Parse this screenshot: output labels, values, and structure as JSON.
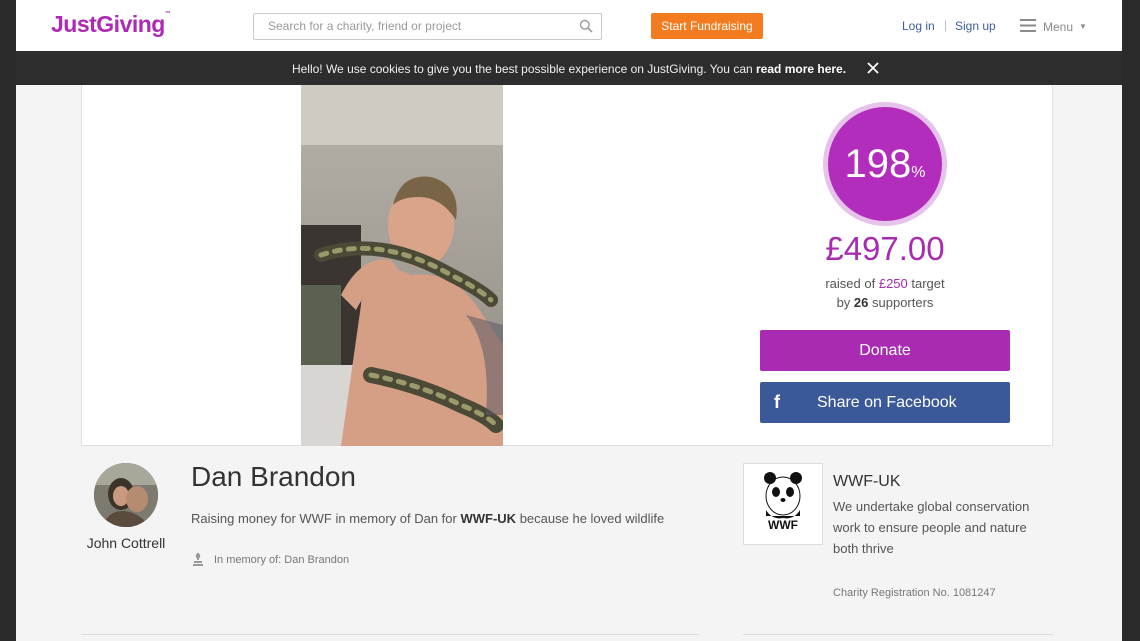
{
  "header": {
    "logo": "JustGiving",
    "logo_tm": "™",
    "search_placeholder": "Search for a charity, friend or project",
    "start_fundraising": "Start Fundraising",
    "login": "Log in",
    "separator": "|",
    "signup": "Sign up",
    "menu": "Menu"
  },
  "cookie_banner": {
    "text": "Hello! We use cookies to give you the best possible experience on JustGiving. You can",
    "link": "read more here."
  },
  "progress": {
    "percent": "198",
    "percent_sign": "%",
    "percent_value": 198,
    "amount_raised": "£497.00",
    "target_prefix": "raised of",
    "target_amount": "£250",
    "target_suffix": "target",
    "supporters_prefix": "by",
    "supporters_count": "26",
    "supporters_suffix": "supporters"
  },
  "actions": {
    "donate": "Donate",
    "share_facebook": "Share on Facebook",
    "facebook_glyph": "f"
  },
  "page": {
    "owner_name": "John Cottrell",
    "title": "Dan Brandon",
    "description_prefix": "Raising money for WWF in memory of Dan for",
    "description_charity": "WWF-UK",
    "description_suffix": "because he loved wildlife",
    "in_memory": "In memory of: Dan Brandon"
  },
  "charity": {
    "logo_text": "WWF",
    "name": "WWF-UK",
    "description": "We undertake global conservation work to ensure people and nature both thrive",
    "registration": "Charity Registration No. 1081247"
  },
  "colors": {
    "brand": "#ad29b6",
    "start_button": "#f47c20",
    "facebook": "#3b5998",
    "link": "#3b5e9f"
  },
  "icons": [
    "search-icon",
    "menu-icon",
    "close-icon",
    "facebook-icon",
    "memory-icon",
    "panda-icon"
  ]
}
